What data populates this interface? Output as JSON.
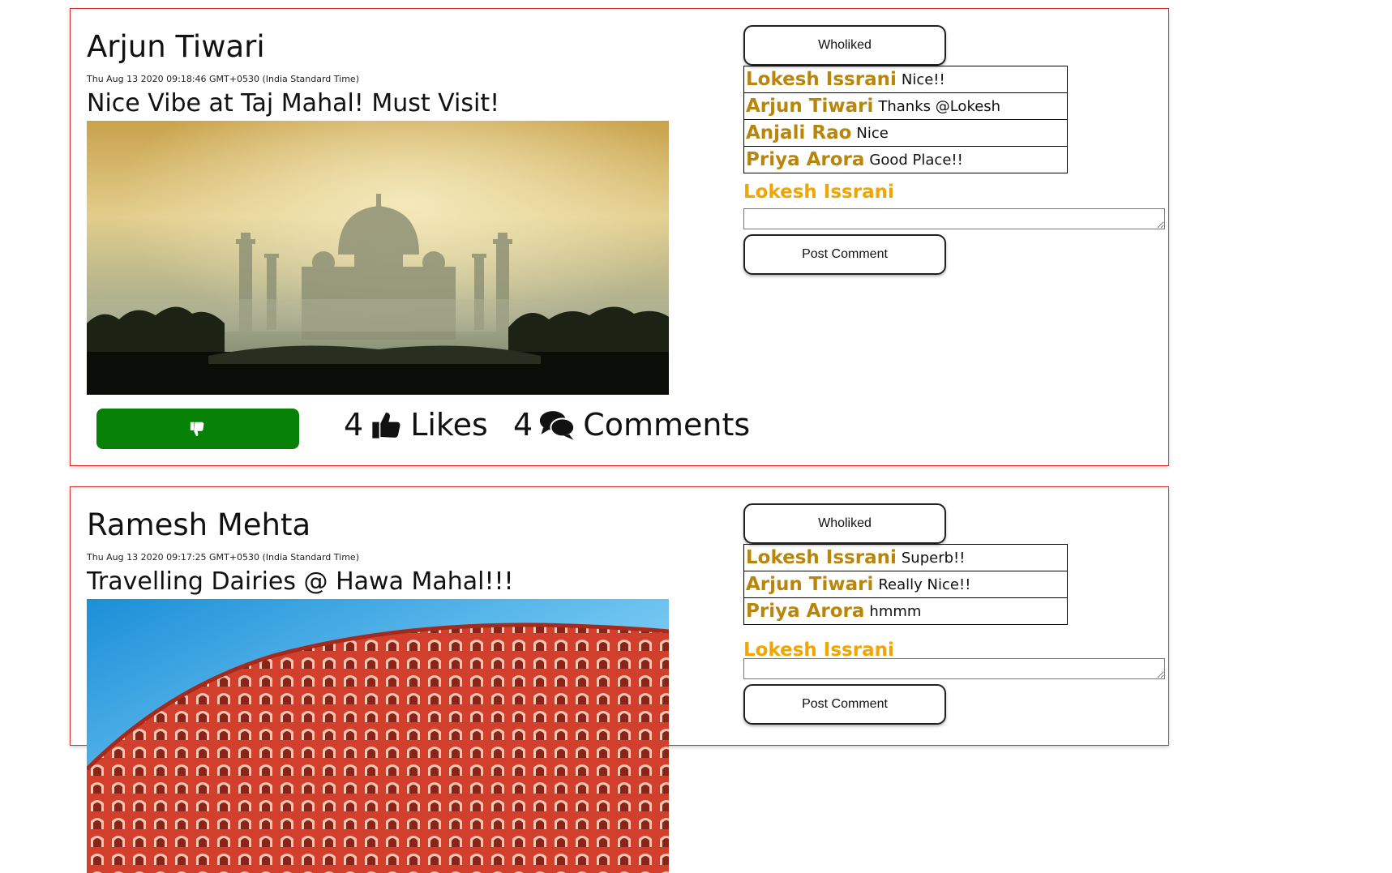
{
  "colors": {
    "card_border": "#e02a2a",
    "dislike_button": "#068106",
    "commenter_name": "#b8860b",
    "current_user": "#f0a500"
  },
  "posts": [
    {
      "author": "Arjun Tiwari",
      "timestamp": "Thu Aug 13 2020 09:18:46 GMT+0530 (India Standard Time)",
      "caption": "Nice Vibe at Taj Mahal! Must Visit!",
      "image": "taj-mahal-photo",
      "dislike_icon": "thumbs-down-icon",
      "likes_count": "4",
      "likes_label": "Likes",
      "likes_icon": "thumbs-up-icon",
      "comments_count": "4",
      "comments_label": "Comments",
      "comments_icon": "comments-icon",
      "wholiked_label": "Wholiked",
      "comments": [
        {
          "name": "Lokesh Issrani",
          "text": "Nice!!"
        },
        {
          "name": "Arjun Tiwari",
          "text": "Thanks @Lokesh"
        },
        {
          "name": "Anjali Rao",
          "text": "Nice"
        },
        {
          "name": "Priya Arora",
          "text": "Good Place!!"
        }
      ],
      "current_user": "Lokesh Issrani",
      "comment_input_value": "",
      "post_comment_label": "Post Comment"
    },
    {
      "author": "Ramesh Mehta",
      "timestamp": "Thu Aug 13 2020 09:17:25 GMT+0530 (India Standard Time)",
      "caption": "Travelling Dairies @ Hawa Mahal!!!",
      "image": "hawa-mahal-photo",
      "wholiked_label": "Wholiked",
      "comments": [
        {
          "name": "Lokesh Issrani",
          "text": "Superb!!"
        },
        {
          "name": "Arjun Tiwari",
          "text": "Really Nice!!"
        },
        {
          "name": "Priya Arora",
          "text": "hmmm"
        }
      ],
      "current_user": "Lokesh Issrani",
      "comment_input_value": "",
      "post_comment_label": "Post Comment"
    }
  ]
}
